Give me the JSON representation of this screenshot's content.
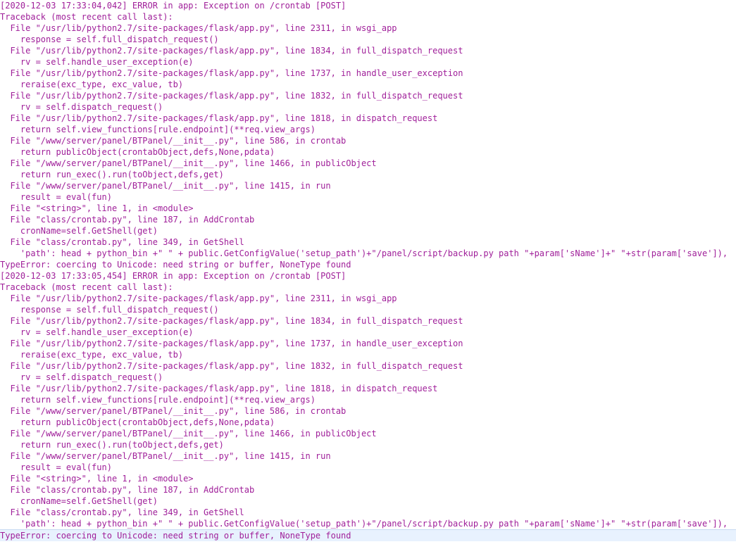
{
  "log": {
    "lines": [
      "[2020-12-03 17:33:04,042] ERROR in app: Exception on /crontab [POST]",
      "Traceback (most recent call last):",
      "  File \"/usr/lib/python2.7/site-packages/flask/app.py\", line 2311, in wsgi_app",
      "    response = self.full_dispatch_request()",
      "  File \"/usr/lib/python2.7/site-packages/flask/app.py\", line 1834, in full_dispatch_request",
      "    rv = self.handle_user_exception(e)",
      "  File \"/usr/lib/python2.7/site-packages/flask/app.py\", line 1737, in handle_user_exception",
      "    reraise(exc_type, exc_value, tb)",
      "  File \"/usr/lib/python2.7/site-packages/flask/app.py\", line 1832, in full_dispatch_request",
      "    rv = self.dispatch_request()",
      "  File \"/usr/lib/python2.7/site-packages/flask/app.py\", line 1818, in dispatch_request",
      "    return self.view_functions[rule.endpoint](**req.view_args)",
      "  File \"/www/server/panel/BTPanel/__init__.py\", line 586, in crontab",
      "    return publicObject(crontabObject,defs,None,pdata)",
      "  File \"/www/server/panel/BTPanel/__init__.py\", line 1466, in publicObject",
      "    return run_exec().run(toObject,defs,get)",
      "  File \"/www/server/panel/BTPanel/__init__.py\", line 1415, in run",
      "    result = eval(fun)",
      "  File \"<string>\", line 1, in <module>",
      "  File \"class/crontab.py\", line 187, in AddCrontab",
      "    cronName=self.GetShell(get)",
      "  File \"class/crontab.py\", line 349, in GetShell",
      "    'path': head + python_bin +\" \" + public.GetConfigValue('setup_path')+\"/panel/script/backup.py path \"+param['sName']+\" \"+str(param['save']),",
      "TypeError: coercing to Unicode: need string or buffer, NoneType found",
      "[2020-12-03 17:33:05,454] ERROR in app: Exception on /crontab [POST]",
      "Traceback (most recent call last):",
      "  File \"/usr/lib/python2.7/site-packages/flask/app.py\", line 2311, in wsgi_app",
      "    response = self.full_dispatch_request()",
      "  File \"/usr/lib/python2.7/site-packages/flask/app.py\", line 1834, in full_dispatch_request",
      "    rv = self.handle_user_exception(e)",
      "  File \"/usr/lib/python2.7/site-packages/flask/app.py\", line 1737, in handle_user_exception",
      "    reraise(exc_type, exc_value, tb)",
      "  File \"/usr/lib/python2.7/site-packages/flask/app.py\", line 1832, in full_dispatch_request",
      "    rv = self.dispatch_request()",
      "  File \"/usr/lib/python2.7/site-packages/flask/app.py\", line 1818, in dispatch_request",
      "    return self.view_functions[rule.endpoint](**req.view_args)",
      "  File \"/www/server/panel/BTPanel/__init__.py\", line 586, in crontab",
      "    return publicObject(crontabObject,defs,None,pdata)",
      "  File \"/www/server/panel/BTPanel/__init__.py\", line 1466, in publicObject",
      "    return run_exec().run(toObject,defs,get)",
      "  File \"/www/server/panel/BTPanel/__init__.py\", line 1415, in run",
      "    result = eval(fun)",
      "  File \"<string>\", line 1, in <module>",
      "  File \"class/crontab.py\", line 187, in AddCrontab",
      "    cronName=self.GetShell(get)",
      "  File \"class/crontab.py\", line 349, in GetShell",
      "    'path': head + python_bin +\" \" + public.GetConfigValue('setup_path')+\"/panel/script/backup.py path \"+param['sName']+\" \"+str(param['save']),",
      "TypeError: coercing to Unicode: need string or buffer, NoneType found"
    ]
  },
  "colors": {
    "text": "#a0209a",
    "background": "#ffffff",
    "current_line": "#e8f2fe"
  }
}
